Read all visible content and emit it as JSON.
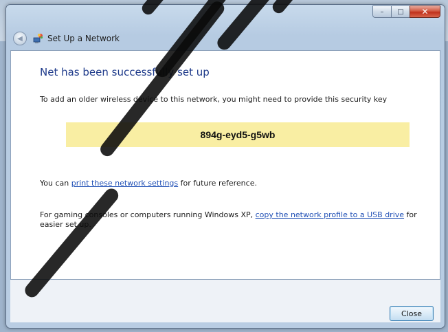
{
  "window": {
    "title": "Set Up a Network",
    "caption": {
      "minimize": "–",
      "maximize": "□",
      "close": "✕"
    }
  },
  "content": {
    "heading": "Net has been successfully set up",
    "instruction": "To add an older wireless device to this network, you might need to provide this security key",
    "security_key": "894g-eyd5-g5wb",
    "print_prefix": "You can ",
    "print_link": "print these network settings",
    "print_suffix": " for future reference.",
    "usb_prefix": "For gaming consoles or computers running Windows XP, ",
    "usb_link": "copy the network profile to a USB drive",
    "usb_suffix": " for easier set up."
  },
  "footer": {
    "close_label": "Close"
  },
  "colors": {
    "heading": "#1e3a8a",
    "key_highlight": "#f9eea3",
    "link": "#1f4fb5"
  },
  "icons": [
    "back-arrow-icon",
    "network-setup-icon",
    "minimize-icon",
    "maximize-icon",
    "close-icon"
  ]
}
